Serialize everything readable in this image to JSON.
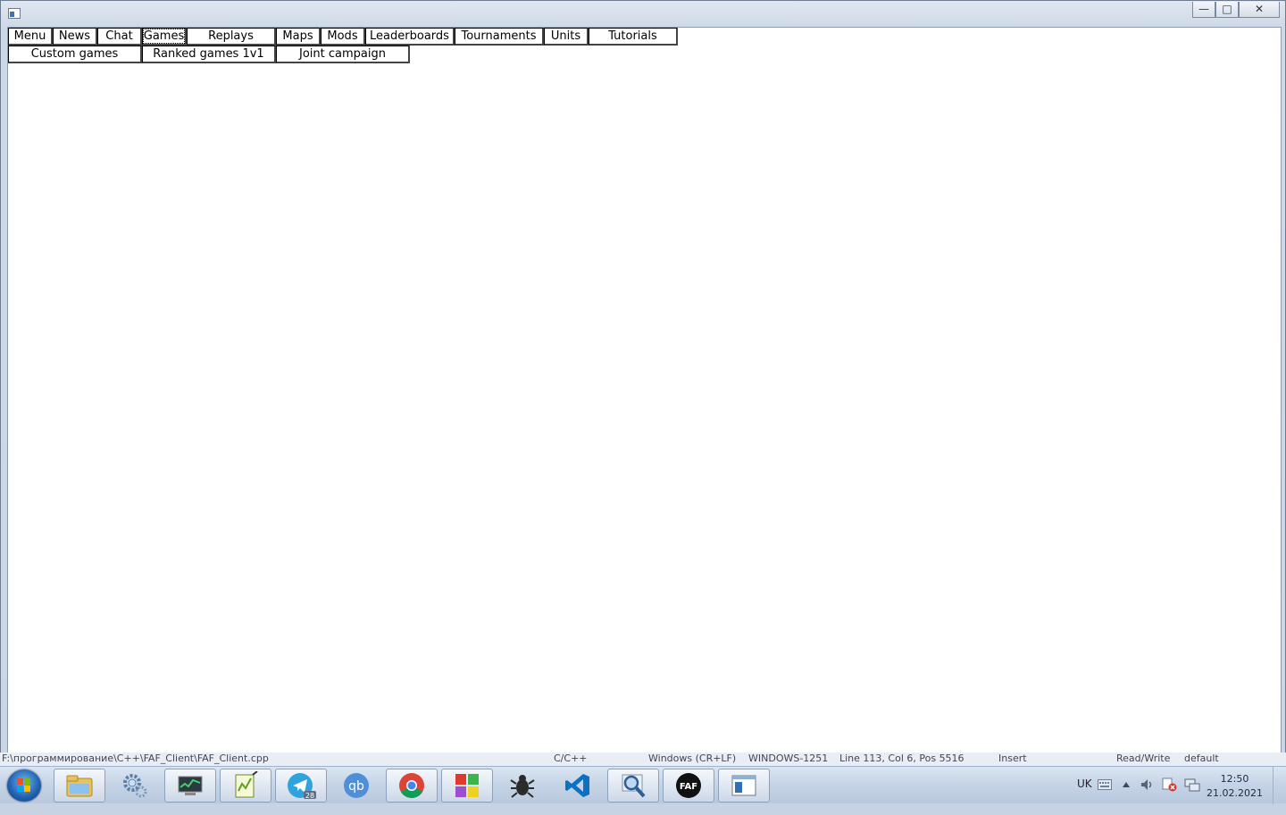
{
  "window": {
    "caption_buttons": {
      "minimize": "—",
      "maximize": "□",
      "close": "✕"
    }
  },
  "menu": {
    "row1": [
      {
        "label": "Menu"
      },
      {
        "label": "News"
      },
      {
        "label": "Chat"
      },
      {
        "label": "Games",
        "active": true
      },
      {
        "label": "Replays"
      },
      {
        "label": "Maps"
      },
      {
        "label": "Mods"
      },
      {
        "label": "Leaderboards"
      },
      {
        "label": "Tournaments"
      },
      {
        "label": "Units"
      },
      {
        "label": "Tutorials"
      }
    ],
    "row2": [
      {
        "label": "Custom games"
      },
      {
        "label": "Ranked games 1v1"
      },
      {
        "label": "Joint campaign"
      }
    ]
  },
  "statusbar": {
    "path": "F:\\программирование\\C++\\FAF_Client\\FAF_Client.cpp",
    "language": "C/C++",
    "line_endings": "Windows (CR+LF)",
    "encoding": "WINDOWS-1251",
    "position": "Line 113, Col 6, Pos 5516",
    "mode": "Insert",
    "access": "Read/Write",
    "scheme": "default"
  },
  "taskbar": {
    "apps": [
      {
        "icon": "file-explorer-icon",
        "open": true
      },
      {
        "icon": "settings-gears-icon",
        "open": false
      },
      {
        "icon": "system-monitor-icon",
        "open": true
      },
      {
        "icon": "notepad-plus-plus-icon",
        "open": true
      },
      {
        "icon": "telegram-icon",
        "badge": "28",
        "open": true
      },
      {
        "icon": "qbittorrent-icon",
        "open": false
      },
      {
        "icon": "chrome-icon",
        "open": true
      },
      {
        "icon": "colorful-windows-app-icon",
        "open": true
      },
      {
        "icon": "bug-icon",
        "open": false
      },
      {
        "icon": "vscode-icon",
        "open": false
      },
      {
        "icon": "magnifier-search-icon",
        "open": true
      },
      {
        "icon": "faf-client-icon",
        "open": true
      },
      {
        "icon": "app-window-icon",
        "open": true
      }
    ],
    "tray": {
      "language": "UK",
      "time": "12:50",
      "date": "21.02.2021"
    }
  },
  "colors": {
    "accent": "#2b6cb0",
    "client_bg": "#ffffff",
    "frame": "#cbd6e4"
  }
}
